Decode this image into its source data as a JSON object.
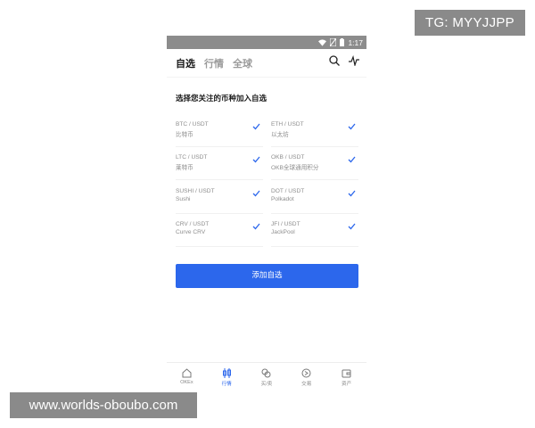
{
  "watermarks": {
    "top": "TG: MYYJJPP",
    "bottom": "www.worlds-oboubo.com"
  },
  "status_bar": {
    "time": "1:17",
    "icons": [
      "wifi-icon",
      "no-sim-icon",
      "battery-icon"
    ]
  },
  "header": {
    "tabs": [
      {
        "label": "自选",
        "active": true
      },
      {
        "label": "行情",
        "active": false
      },
      {
        "label": "全球",
        "active": false
      }
    ],
    "icons": [
      "search-icon",
      "pulse-icon"
    ]
  },
  "main": {
    "heading": "选择您关注的币种加入自选",
    "coins": [
      {
        "pair": "BTC / USDT",
        "name": "比特币",
        "selected": true
      },
      {
        "pair": "ETH / USDT",
        "name": "以太坊",
        "selected": true
      },
      {
        "pair": "LTC / USDT",
        "name": "莱特币",
        "selected": true
      },
      {
        "pair": "OKB / USDT",
        "name": "OKB全球通用积分",
        "selected": true
      },
      {
        "pair": "SUSHI / USDT",
        "name": "Sushi",
        "selected": true
      },
      {
        "pair": "DOT / USDT",
        "name": "Polkadot",
        "selected": true
      },
      {
        "pair": "CRV / USDT",
        "name": "Curve CRV",
        "selected": true
      },
      {
        "pair": "JFI / USDT",
        "name": "JackPool",
        "selected": true
      }
    ],
    "add_button": "添加自选"
  },
  "bottom_nav": [
    {
      "label": "OKEx",
      "icon": "home-icon",
      "active": false
    },
    {
      "label": "行情",
      "icon": "candlestick-icon",
      "active": true
    },
    {
      "label": "买/卖",
      "icon": "swap-icon",
      "active": false
    },
    {
      "label": "交易",
      "icon": "trade-icon",
      "active": false
    },
    {
      "label": "资产",
      "icon": "wallet-icon",
      "active": false
    }
  ],
  "colors": {
    "accent": "#2c67ec",
    "muted": "#8e8e8e",
    "status_bar": "#8c8c8c"
  }
}
